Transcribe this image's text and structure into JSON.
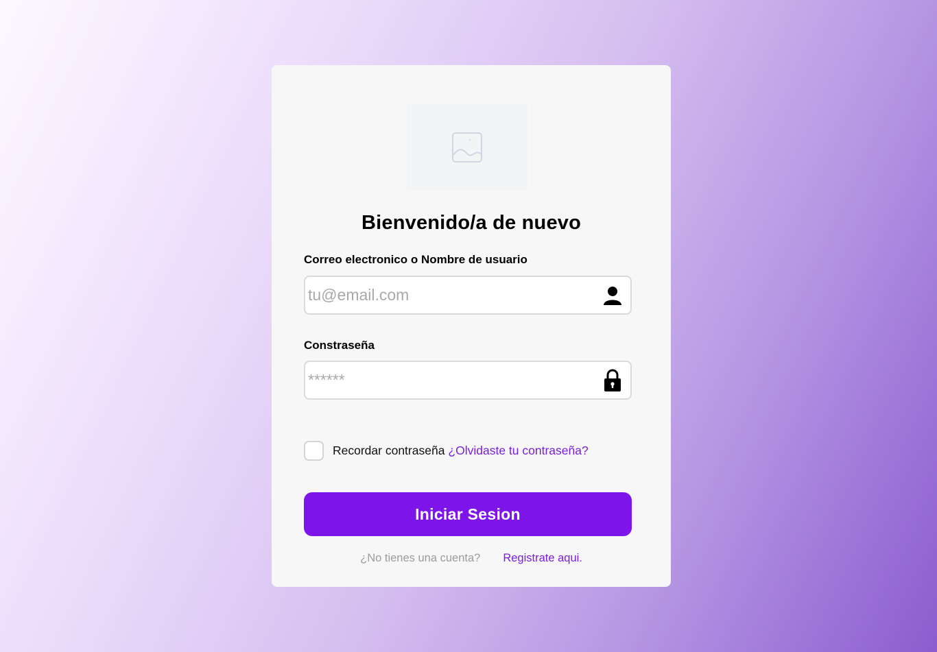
{
  "header": {
    "logo_icon": "image-placeholder-icon",
    "title": "Bienvenido/a de nuevo"
  },
  "form": {
    "email_label": "Correo electronico o Nombre de usuario",
    "email_value": "",
    "email_placeholder": "tu@email.com",
    "email_icon": "user-icon",
    "password_label": "Constraseña",
    "password_value": "",
    "password_placeholder": "******",
    "password_icon": "lock-icon",
    "remember_checked": false,
    "remember_label": "Recordar contraseña",
    "forgot_link": "¿Olvidaste tu contraseña?",
    "submit_label": "Iniciar Sesion"
  },
  "footer": {
    "question": "¿No tienes una cuenta?",
    "register_link": "Registrate aqui."
  },
  "colors": {
    "accent": "#7d14ea",
    "link": "#7a1ee0",
    "card_bg": "#f7f7f7"
  }
}
